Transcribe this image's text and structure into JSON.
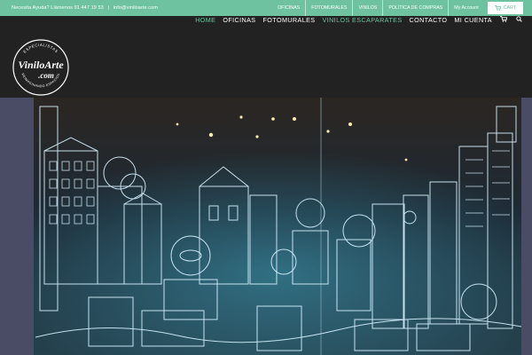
{
  "topbar": {
    "contact_text": "Necesita Ayuda? Llámenos 91 447 19 53",
    "email": "info@viniloarte.com",
    "links": [
      {
        "label": "OFICINAS"
      },
      {
        "label": "FOTOMURALES"
      },
      {
        "label": "VINILOS"
      },
      {
        "label": "POLÍTICA DE COMPRAS"
      },
      {
        "label": "My Account"
      }
    ],
    "cart_label": "CART",
    "cart_icon": "cart-icon",
    "color": "#6ec2a0"
  },
  "logo": {
    "text_main": "ViniloArte",
    "text_dotcom": ".com",
    "ring_top": "ESPECIALISTAS",
    "ring_bottom": "REIMAGINANDO ESPACIOS"
  },
  "nav": {
    "items": [
      {
        "label": "HOME",
        "state": "active"
      },
      {
        "label": "OFICINAS",
        "state": "normal"
      },
      {
        "label": "FOTOMURALES",
        "state": "normal"
      },
      {
        "label": "VINILOS ESCAPARATES",
        "state": "highlight"
      },
      {
        "label": "CONTACTO",
        "state": "normal"
      },
      {
        "label": "MI CUENTA",
        "state": "normal"
      }
    ],
    "icons": [
      "cart-icon",
      "search-icon"
    ]
  },
  "hero": {
    "description": "Shop window decorated with a white line-art city illustration vinyl",
    "colors": {
      "glass": "#1d2a35",
      "lines": "#d8f2ff",
      "glow": "#45b9d6",
      "frame": "#4a4c66"
    }
  }
}
